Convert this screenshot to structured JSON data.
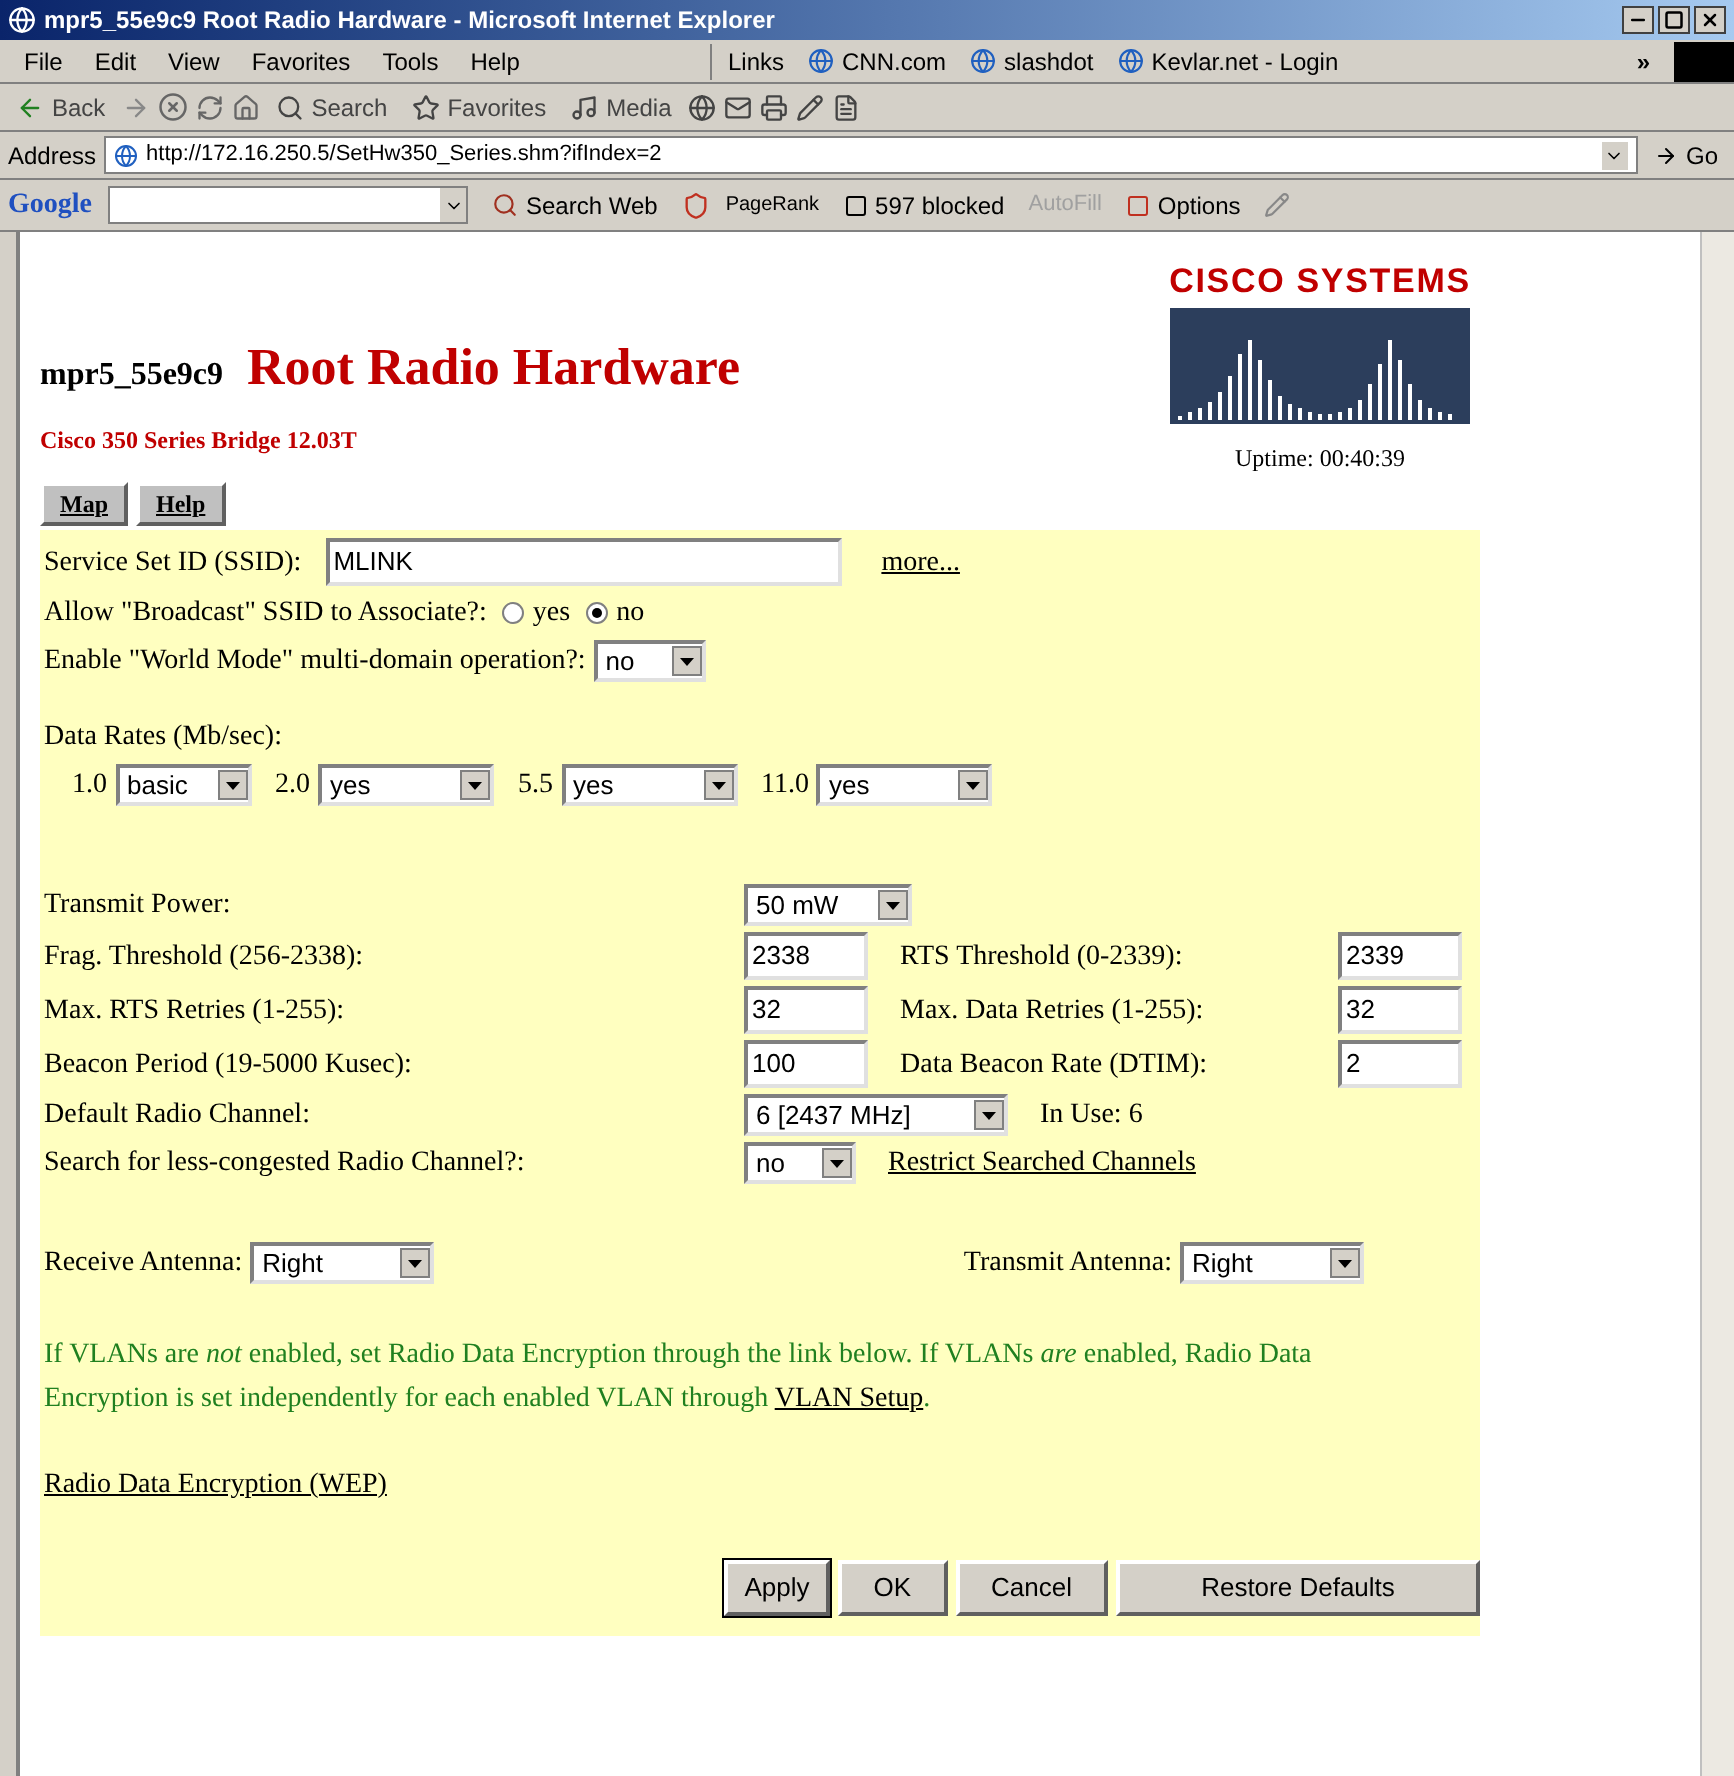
{
  "window": {
    "title": "mpr5_55e9c9 Root Radio Hardware - Microsoft Internet Explorer"
  },
  "menu": [
    "File",
    "Edit",
    "View",
    "Favorites",
    "Tools",
    "Help"
  ],
  "links": {
    "label": "Links",
    "items": [
      "CNN.com",
      "slashdot",
      "Kevlar.net - Login"
    ],
    "more": "»"
  },
  "toolbar": {
    "back": "Back",
    "search": "Search",
    "favorites": "Favorites",
    "media": "Media"
  },
  "address": {
    "label": "Address",
    "value": "http://172.16.250.5/SetHw350_Series.shm?ifIndex=2",
    "go": "Go"
  },
  "google": {
    "logo": "Google",
    "search_web": "Search Web",
    "pagerank": "PageRank",
    "blocked": "597 blocked",
    "autofill": "AutoFill",
    "autofill_disabled": true,
    "options": "Options"
  },
  "page": {
    "host": "mpr5_55e9c9",
    "title": "Root Radio Hardware",
    "subtitle": "Cisco 350 Series Bridge 12.03T",
    "logo": "CISCO SYSTEMS",
    "uptime": "Uptime: 00:40:39",
    "nav": [
      "Map",
      "Help"
    ]
  },
  "form": {
    "ssid": {
      "label": "Service Set ID (SSID):",
      "value": "MLINK",
      "link": "more..."
    },
    "broadcast": {
      "label": "Allow \"Broadcast\" SSID to Associate?:",
      "options": [
        {
          "label": "yes",
          "selected": false
        },
        {
          "label": "no",
          "selected": true
        }
      ]
    },
    "world_mode": {
      "label": "Enable \"World Mode\" multi-domain operation?:",
      "value": "no"
    },
    "data_rates": {
      "label": "Data Rates  (Mb/sec):",
      "rates": [
        {
          "rate": "1.0",
          "value": "basic"
        },
        {
          "rate": "2.0",
          "value": "yes"
        },
        {
          "rate": "5.5",
          "value": "yes"
        },
        {
          "rate": "11.0",
          "value": "yes"
        }
      ]
    },
    "transmit_power": {
      "label": "Transmit Power:",
      "value": "50 mW"
    },
    "pairs": [
      {
        "left": {
          "label": "Frag. Threshold (256-2338):",
          "value": "2338"
        },
        "right": {
          "label": "RTS Threshold (0-2339):",
          "value": "2339"
        }
      },
      {
        "left": {
          "label": "Max. RTS Retries (1-255):",
          "value": "32"
        },
        "right": {
          "label": "Max. Data Retries (1-255):",
          "value": "32"
        }
      },
      {
        "left": {
          "label": "Beacon Period (19-5000 Kusec):",
          "value": "100"
        },
        "right": {
          "label": "Data Beacon Rate (DTIM):",
          "value": "2"
        }
      }
    ],
    "channel": {
      "label": "Default Radio Channel:",
      "value": "6 [2437 MHz]",
      "in_use": "In Use: 6"
    },
    "search_channel": {
      "label": "Search for less-congested Radio Channel?:",
      "value": "no",
      "link": "Restrict Searched Channels"
    },
    "receive_antenna": {
      "label": "Receive Antenna:",
      "value": "Right"
    },
    "transmit_antenna": {
      "label": "Transmit Antenna:",
      "value": "Right"
    },
    "note": {
      "text": "If VLANs are *not* enabled, set Radio Data Encryption through the link below. If VLANs *are* enabled, Radio Data Encryption is set independently for each enabled VLAN through",
      "link": "VLAN Setup",
      "end": "."
    },
    "wep_link": "Radio Data Encryption (WEP)",
    "buttons": [
      {
        "label": "Apply",
        "default": true
      },
      {
        "label": "OK",
        "default": false
      },
      {
        "label": "Cancel",
        "default": false
      },
      {
        "label": "Restore Defaults",
        "default": false
      }
    ]
  }
}
